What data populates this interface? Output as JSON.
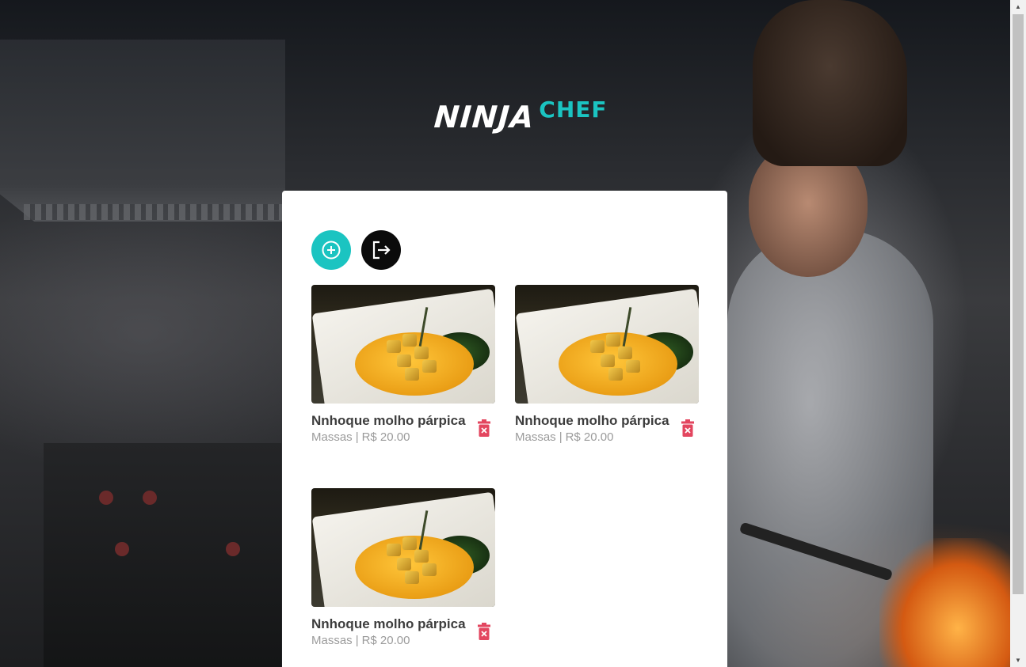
{
  "logo": {
    "ninja": "NINJA",
    "chef": "CHEF"
  },
  "actions": {
    "add_icon": "plus-circle-icon",
    "logout_icon": "logout-icon"
  },
  "items": [
    {
      "name": "Nnhoque molho párpica",
      "category": "Massas",
      "separator": "|",
      "price": "R$ 20.00"
    },
    {
      "name": "Nnhoque molho párpica",
      "category": "Massas",
      "separator": "|",
      "price": "R$ 20.00"
    },
    {
      "name": "Nnhoque molho párpica",
      "category": "Massas",
      "separator": "|",
      "price": "R$ 20.00"
    }
  ],
  "colors": {
    "accent": "#1bc4c1",
    "danger": "#e3465f",
    "dark": "#0b0b0b"
  }
}
